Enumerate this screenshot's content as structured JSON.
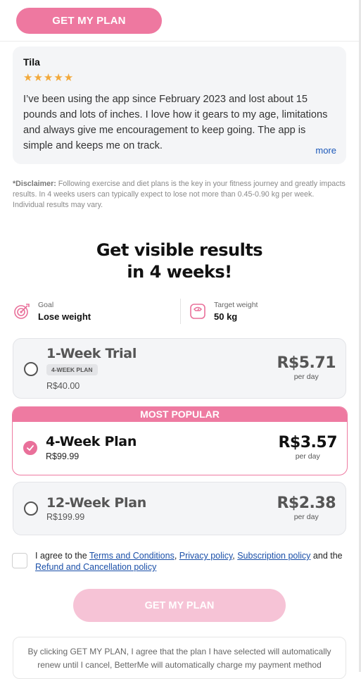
{
  "top_cta": {
    "label": "GET MY PLAN"
  },
  "review": {
    "author": "Tila",
    "stars": "★★★★★",
    "star_color": "#f2a93b",
    "text": "I’ve been using the app since February 2023 and lost about 15 pounds and lots of inches. I love how it gears to my age, limitations and always give me encouragement to keep going. The app is simple and keeps me on track.",
    "more_label": "more"
  },
  "disclaimer": {
    "label": "*Disclaimer:",
    "text": " Following exercise and diet plans is the key in your fitness journey and greatly impacts results. In 4 weeks users can typically expect to lose not more than 0.45-0.90 kg per week. Individual results may vary."
  },
  "headline": {
    "line1": "Get visible results",
    "line2": "in 4 weeks!"
  },
  "goal": {
    "left": {
      "caption": "Goal",
      "value": "Lose weight",
      "icon": "target-icon"
    },
    "right": {
      "caption": "Target weight",
      "value": "50 kg",
      "icon": "scale-icon"
    }
  },
  "plans": [
    {
      "title": "1-Week Trial",
      "badge": "4-WEEK PLAN",
      "old_price": "R$40.00",
      "price": "R$5.71",
      "per": "per day",
      "selected": false
    },
    {
      "title": "4-Week Plan",
      "old_price": "R$99.99",
      "price": "R$3.57",
      "per": "per day",
      "selected": true,
      "tag": "MOST POPULAR"
    },
    {
      "title": "12-Week Plan",
      "old_price": "R$199.99",
      "price": "R$2.38",
      "per": "per day",
      "selected": false
    }
  ],
  "agree": {
    "prefix": "I agree to the ",
    "terms": "Terms and Conditions",
    "comma1": ", ",
    "privacy": "Privacy policy",
    "comma2": ", ",
    "subscription": "Subscription policy",
    "and": " and the ",
    "refund": "Refund and Cancellation policy",
    "checked": false
  },
  "bottom_cta": {
    "label": "GET MY PLAN",
    "enabled": false
  },
  "renewal": {
    "text": "By clicking GET MY PLAN, I agree that the plan I have selected will automatically renew until I cancel, BetterMe will automatically charge my payment method"
  },
  "colors": {
    "accent": "#ee78a0",
    "link": "#1a57b9"
  }
}
